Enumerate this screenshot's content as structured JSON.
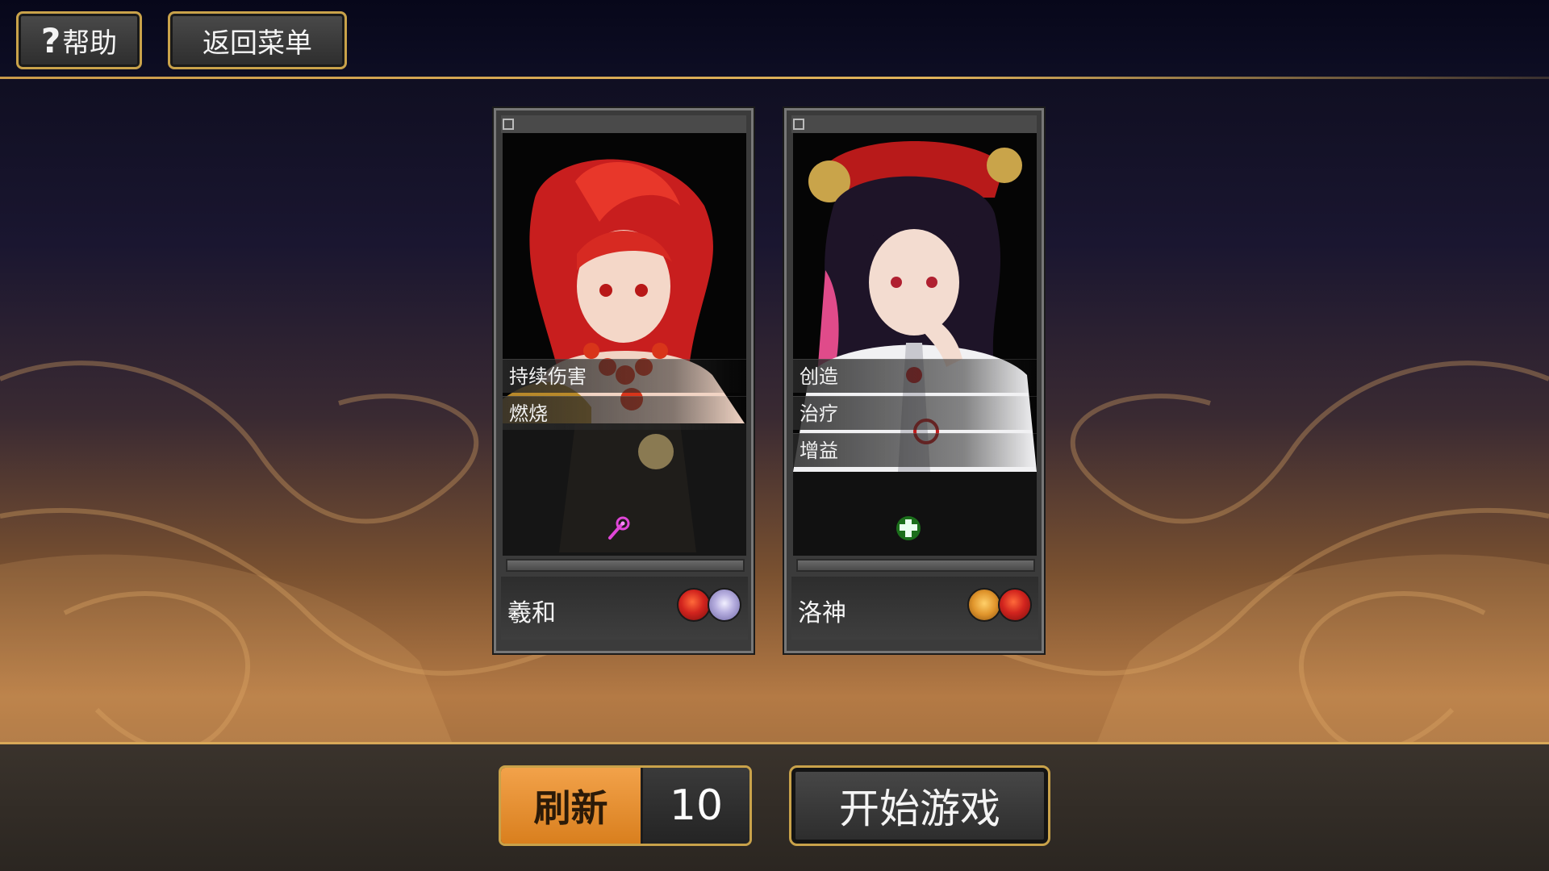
{
  "topbar": {
    "help_icon": "question-mark-icon",
    "help_label": "帮助",
    "menu_label": "返回菜单"
  },
  "cards": [
    {
      "tags": [
        "持续伤害",
        "燃烧"
      ],
      "role_icon": "magic-wand-icon",
      "name": "羲和",
      "elements": [
        "fire-element-icon",
        "void-element-icon"
      ]
    },
    {
      "tags": [
        "创造",
        "治疗",
        "增益"
      ],
      "role_icon": "healing-cross-icon",
      "name": "洛神",
      "elements": [
        "earth-element-icon",
        "fire-element-icon"
      ]
    }
  ],
  "bottombar": {
    "refresh_label": "刷新",
    "refresh_count": "10",
    "start_label": "开始游戏"
  },
  "colors": {
    "accent_gold": "#c9a24a",
    "refresh_orange": "#e8912e"
  }
}
